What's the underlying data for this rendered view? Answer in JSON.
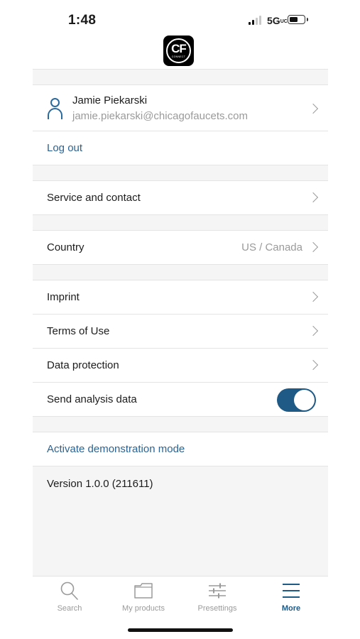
{
  "status_bar": {
    "time": "1:48",
    "network": "5G",
    "network_suffix": "UC"
  },
  "logo": {
    "text": "CF",
    "subtext": "CONNECT"
  },
  "profile": {
    "name": "Jamie Piekarski",
    "email": "jamie.piekarski@chicagofaucets.com",
    "icon": "user-icon"
  },
  "logout_label": "Log out",
  "service_label": "Service and contact",
  "country": {
    "label": "Country",
    "value": "US / Canada"
  },
  "legal": {
    "imprint": "Imprint",
    "terms": "Terms of Use",
    "data_protection": "Data protection"
  },
  "analysis": {
    "label": "Send analysis data",
    "enabled": true
  },
  "demo_label": "Activate demonstration mode",
  "version": "Version 1.0.0 (211611)",
  "tabs": [
    {
      "label": "Search",
      "icon": "search-icon",
      "active": false
    },
    {
      "label": "My products",
      "icon": "folder-icon",
      "active": false
    },
    {
      "label": "Presettings",
      "icon": "sliders-icon",
      "active": false
    },
    {
      "label": "More",
      "icon": "menu-icon",
      "active": true
    }
  ],
  "colors": {
    "accent": "#1e5a85",
    "link": "#2a6394",
    "muted": "#9a9a9a",
    "background": "#f5f5f5"
  }
}
